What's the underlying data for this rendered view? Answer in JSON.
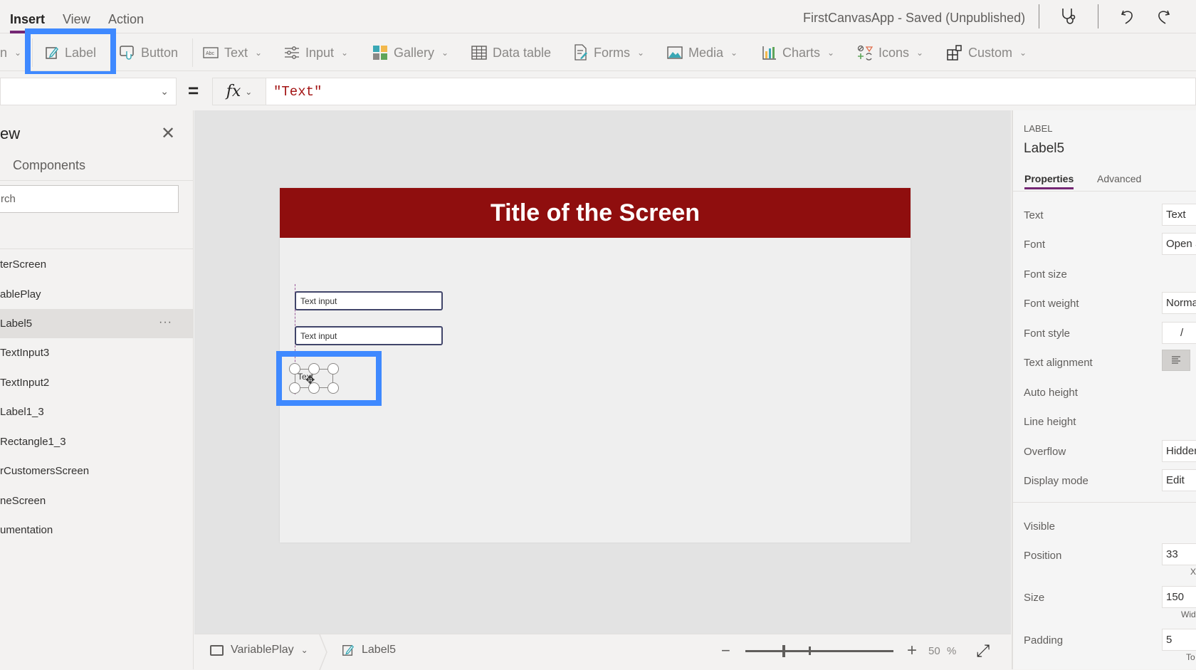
{
  "topbar": {
    "tabs": [
      {
        "label": "Insert",
        "active": true
      },
      {
        "label": "View",
        "active": false
      },
      {
        "label": "Action",
        "active": false
      }
    ],
    "app_title": "FirstCanvasApp - Saved (Unpublished)",
    "icons": [
      "app-checker-icon",
      "undo-icon",
      "redo-icon"
    ]
  },
  "ribbon": {
    "items": [
      {
        "label": "n",
        "icon": "new-screen-icon",
        "dropdown": true
      },
      {
        "label": "Label",
        "icon": "label-edit-icon",
        "dropdown": false,
        "highlighted": true
      },
      {
        "label": "Button",
        "icon": "button-icon",
        "dropdown": false
      },
      {
        "label": "Text",
        "icon": "text-abc-icon",
        "dropdown": true
      },
      {
        "label": "Input",
        "icon": "input-sliders-icon",
        "dropdown": true
      },
      {
        "label": "Gallery",
        "icon": "gallery-icon",
        "dropdown": true
      },
      {
        "label": "Data table",
        "icon": "data-table-icon",
        "dropdown": false
      },
      {
        "label": "Forms",
        "icon": "forms-icon",
        "dropdown": true
      },
      {
        "label": "Media",
        "icon": "media-icon",
        "dropdown": true
      },
      {
        "label": "Charts",
        "icon": "charts-icon",
        "dropdown": true
      },
      {
        "label": "Icons",
        "icon": "icons-icon",
        "dropdown": true
      },
      {
        "label": "Custom",
        "icon": "custom-icon",
        "dropdown": true
      }
    ]
  },
  "formula_bar": {
    "property": "",
    "equals": "=",
    "fx_label": "fx",
    "formula": "\"Text\""
  },
  "tree_view": {
    "title": "ew",
    "tab": "Components",
    "search_placeholder": "rch",
    "items": [
      {
        "label": "terScreen",
        "selected": false
      },
      {
        "label": "ablePlay",
        "selected": false
      },
      {
        "label": "Label5",
        "selected": true
      },
      {
        "label": "TextInput3",
        "selected": false
      },
      {
        "label": "TextInput2",
        "selected": false
      },
      {
        "label": "Label1_3",
        "selected": false
      },
      {
        "label": "Rectangle1_3",
        "selected": false
      },
      {
        "label": "rCustomersScreen",
        "selected": false
      },
      {
        "label": "neScreen",
        "selected": false
      },
      {
        "label": "umentation",
        "selected": false
      }
    ],
    "more_label": "···"
  },
  "canvas": {
    "title": "Title of the Screen",
    "title_color": "#8f0e0e",
    "text_input_1": "Text input",
    "text_input_2": "Text input",
    "label_text": "Text",
    "highlight_color": "#3f89ff"
  },
  "bottom_bar": {
    "screen_name": "VariablePlay",
    "control_name": "Label5",
    "zoom_value": "50",
    "zoom_unit": "%",
    "zoom_minus": "−",
    "zoom_plus": "+",
    "zoom_level_percent": 50
  },
  "properties_panel": {
    "control_type": "LABEL",
    "control_name": "Label5",
    "tabs": [
      {
        "label": "Properties",
        "active": true
      },
      {
        "label": "Advanced",
        "active": false
      }
    ],
    "properties": {
      "text": {
        "label": "Text",
        "value": "Text"
      },
      "font": {
        "label": "Font",
        "value": "Open S"
      },
      "font_size": {
        "label": "Font size"
      },
      "font_weight": {
        "label": "Font weight",
        "value": "Norma"
      },
      "font_style": {
        "label": "Font style",
        "value": "/"
      },
      "text_alignment": {
        "label": "Text alignment"
      },
      "auto_height": {
        "label": "Auto height"
      },
      "line_height": {
        "label": "Line height"
      },
      "overflow": {
        "label": "Overflow",
        "value": "Hidden"
      },
      "display_mode": {
        "label": "Display mode",
        "value": "Edit"
      },
      "visible": {
        "label": "Visible"
      },
      "position": {
        "label": "Position",
        "value": "33",
        "sub": "X"
      },
      "size": {
        "label": "Size",
        "value": "150",
        "sub": "Wid"
      },
      "padding": {
        "label": "Padding",
        "value": "5",
        "sub": "To"
      }
    }
  }
}
